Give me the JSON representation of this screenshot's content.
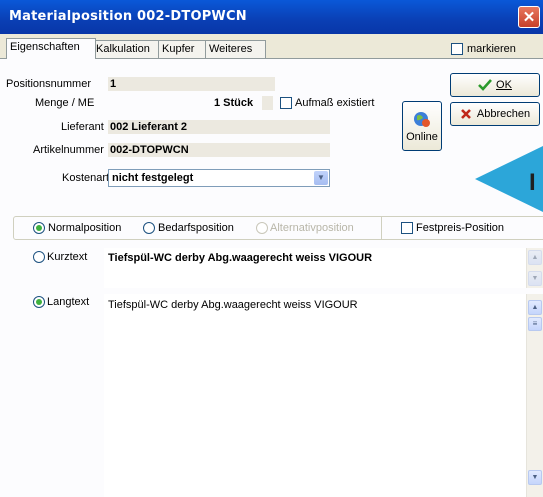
{
  "window": {
    "title": "Materialposition 002-DTOPWCN"
  },
  "tabs": [
    {
      "label": "Eigenschaften"
    },
    {
      "label": "Kalkulation"
    },
    {
      "label": "Kupfer"
    },
    {
      "label": "Weiteres"
    }
  ],
  "markieren": {
    "label": "markieren",
    "checked": false
  },
  "fields": {
    "positionsnummer": {
      "label": "Positionsnummer",
      "value": "1"
    },
    "menge": {
      "label": "Menge / ME",
      "value": "1 Stück"
    },
    "aufmass": {
      "label": "Aufmaß existiert",
      "checked": false
    },
    "lieferant": {
      "label": "Lieferant",
      "value": "002 Lieferant 2"
    },
    "artikelnummer": {
      "label": "Artikelnummer",
      "value": "002-DTOPWCN"
    },
    "kostenart": {
      "label": "Kostenart",
      "value": "nicht festgelegt"
    }
  },
  "buttons": {
    "ok": "OK",
    "abbrechen": "Abbrechen",
    "online": "Online"
  },
  "position_types": [
    {
      "label": "Normalposition",
      "selected": true,
      "enabled": true
    },
    {
      "label": "Bedarfsposition",
      "selected": false,
      "enabled": true
    },
    {
      "label": "Alternativposition",
      "selected": false,
      "enabled": false
    }
  ],
  "festpreis": {
    "label": "Festpreis-Position",
    "checked": false
  },
  "kurztext": {
    "label": "Kurztext",
    "selected": false,
    "value": "Tiefspül-WC derby Abg.waagerecht weiss VIGOUR"
  },
  "langtext": {
    "label": "Langtext",
    "selected": true,
    "value": "Tiefspül-WC derby Abg.waagerecht weiss VIGOUR"
  },
  "overlay": {
    "letter": "I"
  },
  "colors": {
    "titlebar": "#0a58d8",
    "accent_arrow": "#2ca6d9",
    "radio_on": "#3fb13f"
  }
}
